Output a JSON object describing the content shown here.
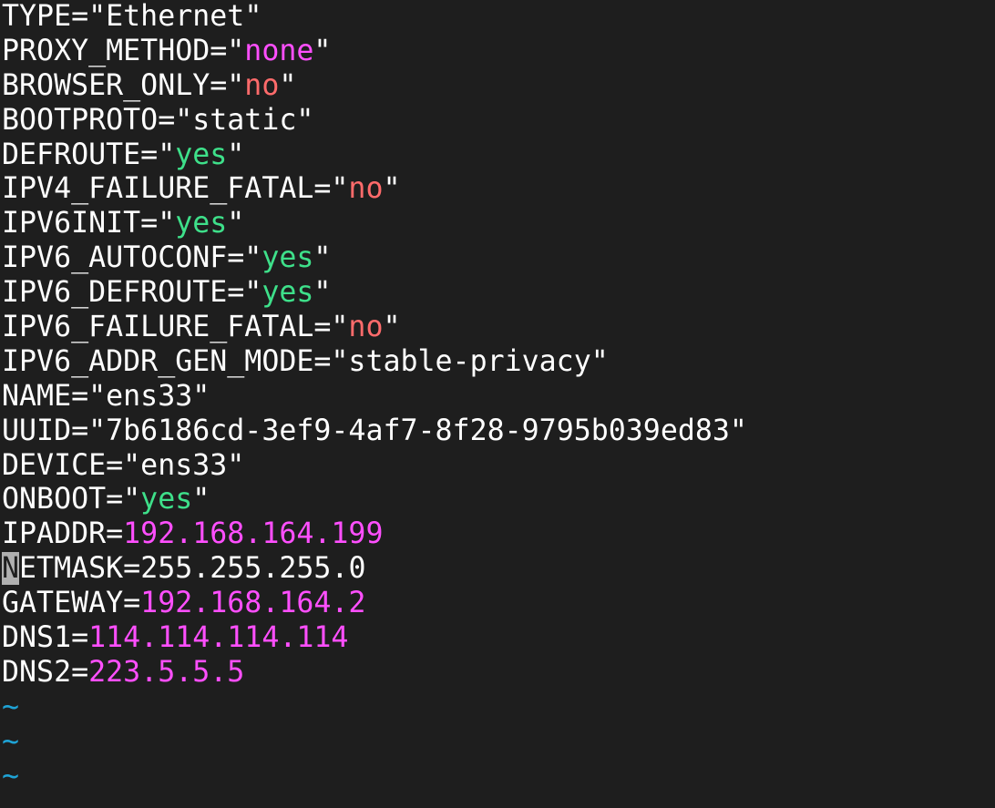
{
  "colors": {
    "background": "#1e1e1e",
    "plain": "#ffffff",
    "value_magenta": "#ff4fff",
    "value_red": "#ff6b6b",
    "value_green": "#3ee08a",
    "tilde": "#1ea3d6",
    "cursor_bg": "#b0b0b0"
  },
  "lines": [
    {
      "key": "TYPE=\"",
      "value": "Ethernet",
      "suffix": "\"",
      "value_color": "plain"
    },
    {
      "key": "PROXY_METHOD=\"",
      "value": "none",
      "suffix": "\"",
      "value_color": "value_magenta"
    },
    {
      "key": "BROWSER_ONLY=\"",
      "value": "no",
      "suffix": "\"",
      "value_color": "value_red"
    },
    {
      "key": "BOOTPROTO=\"",
      "value": "static",
      "suffix": "\"",
      "value_color": "plain"
    },
    {
      "key": "DEFROUTE=\"",
      "value": "yes",
      "suffix": "\"",
      "value_color": "value_green"
    },
    {
      "key": "IPV4_FAILURE_FATAL=\"",
      "value": "no",
      "suffix": "\"",
      "value_color": "value_red"
    },
    {
      "key": "IPV6INIT=\"",
      "value": "yes",
      "suffix": "\"",
      "value_color": "value_green"
    },
    {
      "key": "IPV6_AUTOCONF=\"",
      "value": "yes",
      "suffix": "\"",
      "value_color": "value_green"
    },
    {
      "key": "IPV6_DEFROUTE=\"",
      "value": "yes",
      "suffix": "\"",
      "value_color": "value_green"
    },
    {
      "key": "IPV6_FAILURE_FATAL=\"",
      "value": "no",
      "suffix": "\"",
      "value_color": "value_red"
    },
    {
      "key": "IPV6_ADDR_GEN_MODE=\"",
      "value": "stable-privacy",
      "suffix": "\"",
      "value_color": "plain"
    },
    {
      "key": "NAME=\"",
      "value": "ens33",
      "suffix": "\"",
      "value_color": "plain"
    },
    {
      "key": "UUID=\"",
      "value": "7b6186cd-3ef9-4af7-8f28-9795b039ed83",
      "suffix": "\"",
      "value_color": "plain"
    },
    {
      "key": "DEVICE=\"",
      "value": "ens33",
      "suffix": "\"",
      "value_color": "plain"
    },
    {
      "key": "ONBOOT=\"",
      "value": "yes",
      "suffix": "\"",
      "value_color": "value_green"
    },
    {
      "key": "IPADDR=",
      "value": "192.168.164.199",
      "suffix": "",
      "value_color": "value_magenta"
    },
    {
      "cursor": "N",
      "key": "ETMASK=",
      "value": "255.255.255.0",
      "suffix": "",
      "value_color": "plain"
    },
    {
      "key": "GATEWAY=",
      "value": "192.168.164.2",
      "suffix": "",
      "value_color": "value_magenta"
    },
    {
      "key": "DNS1=",
      "value": "114.114.114.114",
      "suffix": "",
      "value_color": "value_magenta"
    },
    {
      "key": "DNS2=",
      "value": "223.5.5.5",
      "suffix": "",
      "value_color": "value_magenta"
    }
  ],
  "empty_line_markers": [
    "~",
    "~",
    "~"
  ]
}
